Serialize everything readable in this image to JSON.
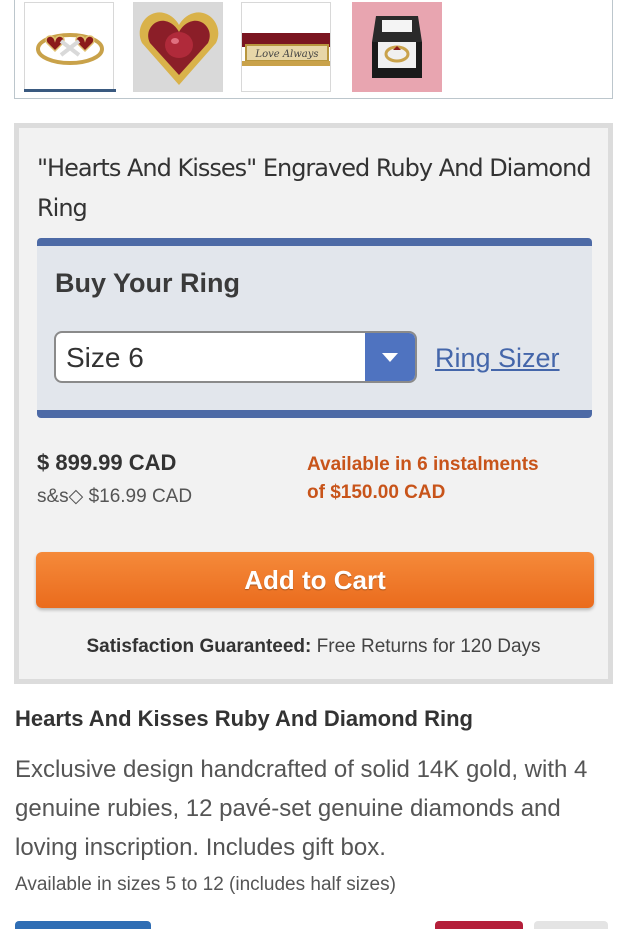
{
  "gallery": {
    "thumbnails": [
      {
        "icon": "ring-thumbnail-icon"
      },
      {
        "icon": "heart-ruby-thumbnail-icon"
      },
      {
        "icon": "engraving-thumbnail-icon",
        "engraving": "Love Always"
      },
      {
        "icon": "gift-box-thumbnail-icon"
      }
    ],
    "active_index": 0
  },
  "product": {
    "title": "\"Hearts And Kisses\" Engraved Ruby And Diamond Ring",
    "buy_heading": "Buy Your Ring",
    "size_select": {
      "value": "Size 6"
    },
    "ring_sizer_link": "Ring Sizer",
    "price": "$ 899.99 CAD",
    "shipping": "s&s◇ $16.99 CAD",
    "instalments_line1": "Available in 6 instalments",
    "instalments_line2": "of $150.00 CAD",
    "add_to_cart": "Add to Cart",
    "guarantee_bold": "Satisfaction Guaranteed:",
    "guarantee_rest": " Free Returns for 120 Days"
  },
  "description": {
    "title": "Hearts And Kisses Ruby And Diamond Ring",
    "body": "Exclusive design handcrafted of solid 14K gold, with 4 genuine rubies, 12 pavé-set genuine diamonds and loving inscription. Includes gift box.",
    "sizes": "Available in sizes 5 to 12 (includes half sizes)"
  },
  "colors": {
    "accent_blue": "#4d6aa6",
    "cart_orange": "#ea6b1d",
    "instalment_orange": "#c8541a",
    "link_blue": "#4466aa"
  }
}
